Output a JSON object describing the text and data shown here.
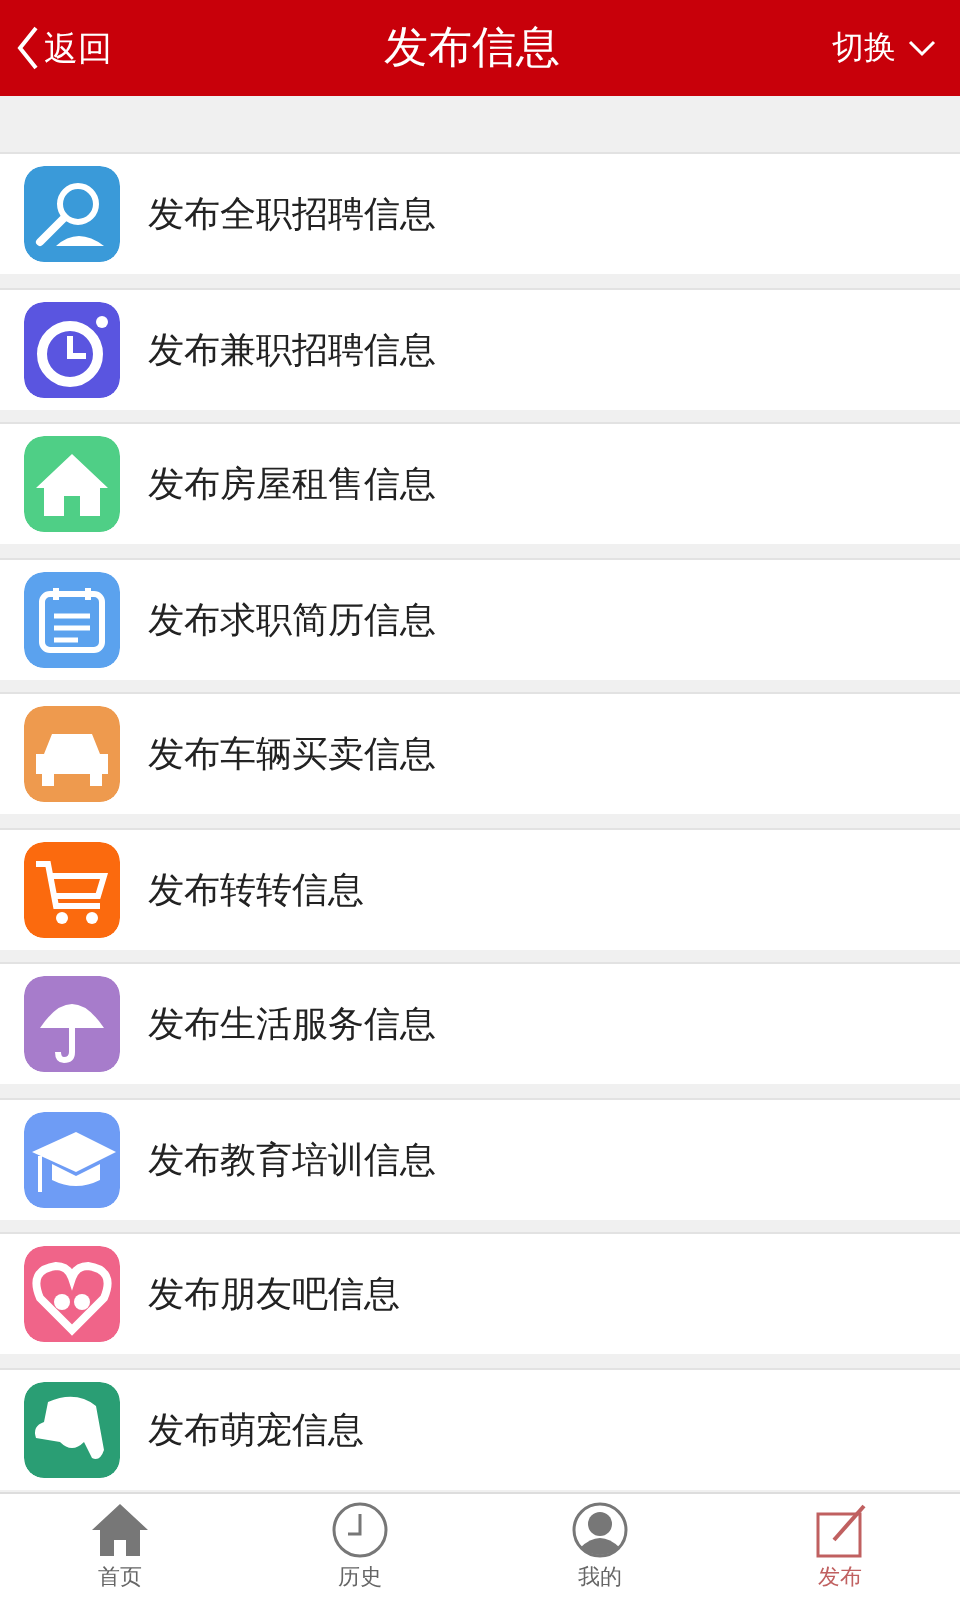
{
  "header": {
    "back": "返回",
    "title": "发布信息",
    "switch": "切换"
  },
  "items": [
    {
      "label": "发布全职招聘信息",
      "kind": "search",
      "color": "#3a9ad9"
    },
    {
      "label": "发布兼职招聘信息",
      "kind": "stopwatch",
      "color": "#5a55e0"
    },
    {
      "label": "发布房屋租售信息",
      "kind": "house",
      "color": "#4fcf86"
    },
    {
      "label": "发布求职简历信息",
      "kind": "calendar",
      "color": "#5ba2ee"
    },
    {
      "label": "发布车辆买卖信息",
      "kind": "car",
      "color": "#ee9a4e"
    },
    {
      "label": "发布转转信息",
      "kind": "cart",
      "color": "#fb6a0e"
    },
    {
      "label": "发布生活服务信息",
      "kind": "umbrella",
      "color": "#a77ccb"
    },
    {
      "label": "发布教育培训信息",
      "kind": "cap",
      "color": "#6e9cf5"
    },
    {
      "label": "发布朋友吧信息",
      "kind": "heart",
      "color": "#f06489"
    },
    {
      "label": "发布萌宠信息",
      "kind": "dog",
      "color": "#2a9e74"
    }
  ],
  "nav": [
    {
      "label": "首页",
      "kind": "home",
      "selected": false
    },
    {
      "label": "历史",
      "kind": "clock",
      "selected": false
    },
    {
      "label": "我的",
      "kind": "user",
      "selected": false
    },
    {
      "label": "发布",
      "kind": "edit",
      "selected": true
    }
  ]
}
